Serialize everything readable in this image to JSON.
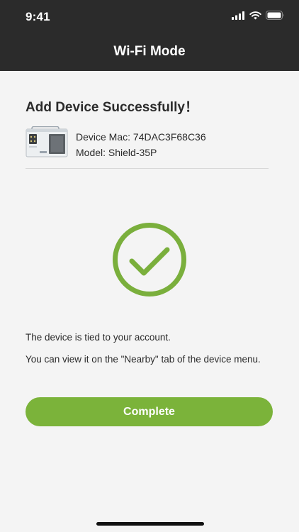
{
  "status_bar": {
    "time": "9:41",
    "icons": [
      "cellular-signal-icon",
      "wifi-icon",
      "battery-icon"
    ]
  },
  "header": {
    "title": "Wi-Fi Mode"
  },
  "main": {
    "title": "Add Device Successfully！",
    "device": {
      "mac": "Device Mac: 74DAC3F68C36",
      "model": "Model: Shield-35P",
      "image_icon": "dehumidifier-device-icon"
    },
    "status_icon": "checkmark-circle-icon",
    "message_line1": "The device is tied to your account.",
    "message_line2": "You can view it on the \"Nearby\" tab of the device menu.",
    "complete_label": "Complete"
  },
  "colors": {
    "header_bg": "#2b2b2b",
    "page_bg": "#f4f4f4",
    "accent": "#7bb33a",
    "check_stroke": "#7aaf3c"
  }
}
